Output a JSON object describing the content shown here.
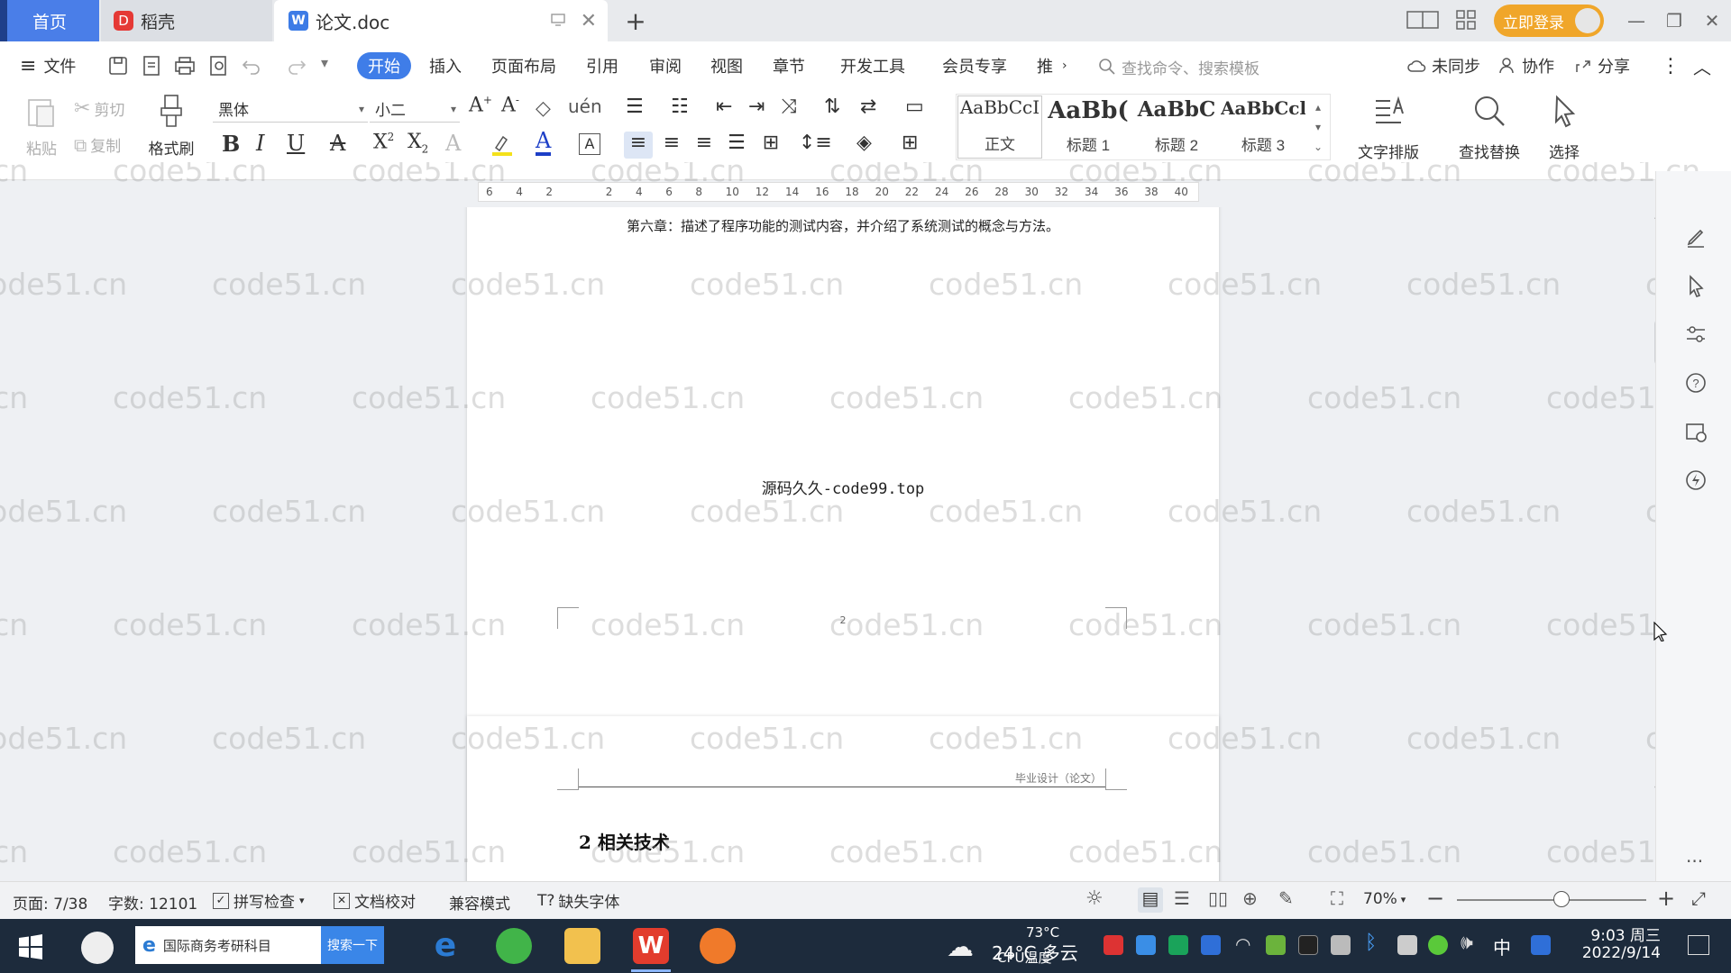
{
  "tabs": {
    "home": "首页",
    "daoke": "稻壳",
    "doc": "论文.doc",
    "login": "立即登录"
  },
  "menu": {
    "file": "文件",
    "items": [
      "开始",
      "插入",
      "页面布局",
      "引用",
      "审阅",
      "视图",
      "章节",
      "开发工具",
      "会员专享",
      "推"
    ],
    "search_cmd": "查找命令、搜索模板",
    "sync": "未同步",
    "collab": "协作",
    "share": "分享"
  },
  "ribbon": {
    "paste": "粘贴",
    "cut": "剪切",
    "copy": "复制",
    "format_painter": "格式刷",
    "font_name": "黑体",
    "font_size": "小二",
    "styles": [
      {
        "preview": "AaBbCcI",
        "name": "正文"
      },
      {
        "preview": "AaBb(",
        "name": "标题 1"
      },
      {
        "preview": "AaBbC",
        "name": "标题 2"
      },
      {
        "preview": "AaBbCcl",
        "name": "标题 3"
      }
    ],
    "text_layout": "文字排版",
    "find_replace": "查找替换",
    "select": "选择"
  },
  "ruler": {
    "ticks": [
      "6",
      "4",
      "2",
      "",
      "2",
      "4",
      "6",
      "8",
      "10",
      "12",
      "14",
      "16",
      "18",
      "20",
      "22",
      "24",
      "26",
      "28",
      "30",
      "32",
      "34",
      "36",
      "38",
      "40"
    ]
  },
  "document": {
    "chapter6_line": "第六章：描述了程序功能的测试内容，并介绍了系统测试的概念与方法。",
    "source_text": "源码久久-code99.top",
    "page_number": "2",
    "header_text": "毕业设计（论文）",
    "heading": "2  相关技术",
    "watermark": "code51.cn"
  },
  "status": {
    "page": "页面: 7/38",
    "words": "字数: 12101",
    "spellcheck": "拼写检查",
    "proofread": "文档校对",
    "compat": "兼容模式",
    "missing_font": "缺失字体",
    "zoom": "70%",
    "zoom_level": 0.55
  },
  "taskbar": {
    "search_text": "国际商务考研科目",
    "search_btn": "搜索一下",
    "weather_temp": "24°C 多云",
    "cpu_temp": "73°C",
    "cpu_label": "CPU温度",
    "ime": "中",
    "time": "9:03 周三",
    "date": "2022/9/14"
  }
}
